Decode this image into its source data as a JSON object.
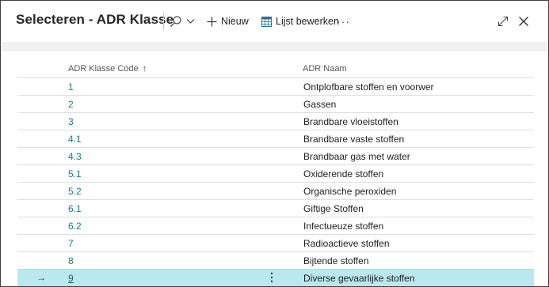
{
  "header": {
    "title": "Selecteren - ADR Klasse",
    "new_label": "Nieuw",
    "edit_list_label": "Lijst bewerken",
    "more_label": "···"
  },
  "table": {
    "columns": [
      "ADR Klasse Code",
      "ADR Naam"
    ],
    "sort_indicator": "↑",
    "rows": [
      {
        "code": "1",
        "name": "Ontplofbare stoffen en voorwer"
      },
      {
        "code": "2",
        "name": "Gassen"
      },
      {
        "code": "3",
        "name": "Brandbare vloeistoffen"
      },
      {
        "code": "4.1",
        "name": "Brandbare vaste stoffen"
      },
      {
        "code": "4.3",
        "name": "Brandbaar gas met water"
      },
      {
        "code": "5.1",
        "name": "Oxiderende stoffen"
      },
      {
        "code": "5.2",
        "name": "Organische peroxiden"
      },
      {
        "code": "6.1",
        "name": "Giftige Stoffen"
      },
      {
        "code": "6.2",
        "name": "Infectueuze stoffen"
      },
      {
        "code": "7",
        "name": "Radioactieve stoffen"
      },
      {
        "code": "8",
        "name": "Bijtende stoffen"
      },
      {
        "code": "9",
        "name": "Diverse gevaarlijke stoffen"
      }
    ],
    "selected_arrow": "→",
    "row_menu": "⋮"
  }
}
